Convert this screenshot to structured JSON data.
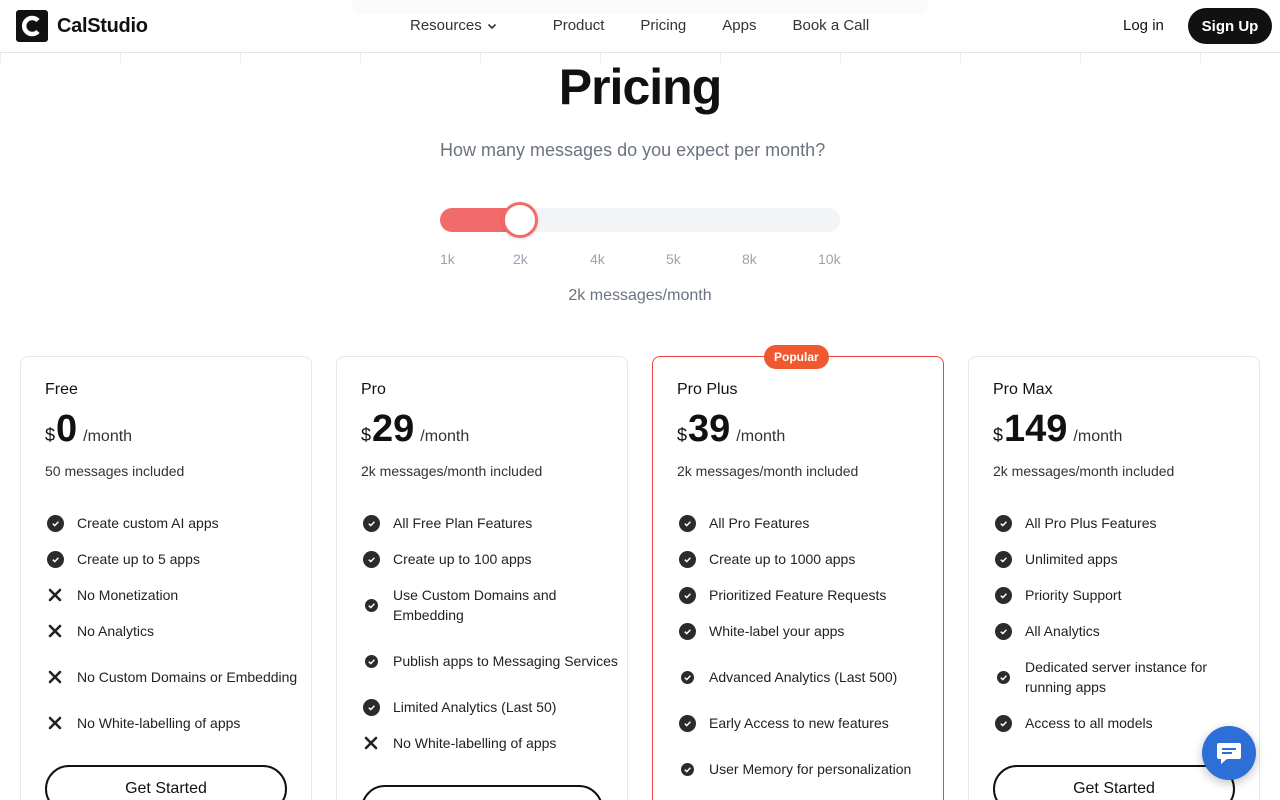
{
  "brand": {
    "name": "CalStudio"
  },
  "nav": {
    "resources": "Resources",
    "items": [
      "Product",
      "Pricing",
      "Apps",
      "Book a Call"
    ]
  },
  "auth": {
    "login": "Log in",
    "signup": "Sign Up"
  },
  "page": {
    "title": "Pricing",
    "question": "How many messages do you expect per month?"
  },
  "slider": {
    "ticks": [
      "1k",
      "2k",
      "4k",
      "5k",
      "8k",
      "10k"
    ],
    "selected_index": 1,
    "value_text": "2k messages/month",
    "accent": "#f26b6b"
  },
  "plans": [
    {
      "name": "Free",
      "currency": "$",
      "price": "0",
      "period": "/month",
      "included": "50 messages included",
      "badge": "",
      "cta": "Get Started",
      "features": [
        {
          "text": "Create custom AI apps",
          "icon": "check"
        },
        {
          "text": "Create up to 5 apps",
          "icon": "check"
        },
        {
          "text": "No Monetization",
          "icon": "x"
        },
        {
          "text": "No Analytics",
          "icon": "x"
        },
        {
          "text": "No Custom Domains or Embedding",
          "icon": "x"
        },
        {
          "text": "No White-labelling of apps",
          "icon": "x"
        }
      ]
    },
    {
      "name": "Pro",
      "currency": "$",
      "price": "29",
      "period": "/month",
      "included": "2k messages/month included",
      "badge": "",
      "cta": "",
      "features": [
        {
          "text": "All Free Plan Features",
          "icon": "check"
        },
        {
          "text": "Create up to 100 apps",
          "icon": "check"
        },
        {
          "text": "Use Custom Domains and Embedding",
          "icon": "check"
        },
        {
          "text": "Publish apps to Messaging Services",
          "icon": "check"
        },
        {
          "text": "Limited Analytics (Last 50)",
          "icon": "check"
        },
        {
          "text": "No White-labelling of apps",
          "icon": "x"
        }
      ]
    },
    {
      "name": "Pro Plus",
      "currency": "$",
      "price": "39",
      "period": "/month",
      "included": "2k messages/month included",
      "badge": "Popular",
      "cta": "",
      "features": [
        {
          "text": "All Pro Features",
          "icon": "check"
        },
        {
          "text": "Create up to 1000 apps",
          "icon": "check"
        },
        {
          "text": "Prioritized Feature Requests",
          "icon": "check"
        },
        {
          "text": "White-label your apps",
          "icon": "check"
        },
        {
          "text": "Advanced Analytics (Last 500)",
          "icon": "check"
        },
        {
          "text": "Early Access to new features",
          "icon": "check"
        },
        {
          "text": "User Memory for personalization",
          "icon": "check"
        }
      ]
    },
    {
      "name": "Pro Max",
      "currency": "$",
      "price": "149",
      "period": "/month",
      "included": "2k messages/month included",
      "badge": "",
      "cta": "Get Started",
      "features": [
        {
          "text": "All Pro Plus Features",
          "icon": "check"
        },
        {
          "text": "Unlimited apps",
          "icon": "check"
        },
        {
          "text": "Priority Support",
          "icon": "check"
        },
        {
          "text": "All Analytics",
          "icon": "check"
        },
        {
          "text": "Dedicated server instance for running apps",
          "icon": "check"
        },
        {
          "text": "Access to all models",
          "icon": "check"
        }
      ]
    }
  ],
  "colors": {
    "popular_badge": "#f0582f",
    "popular_border": "#ef4444",
    "chat": "#2d6fd6"
  }
}
